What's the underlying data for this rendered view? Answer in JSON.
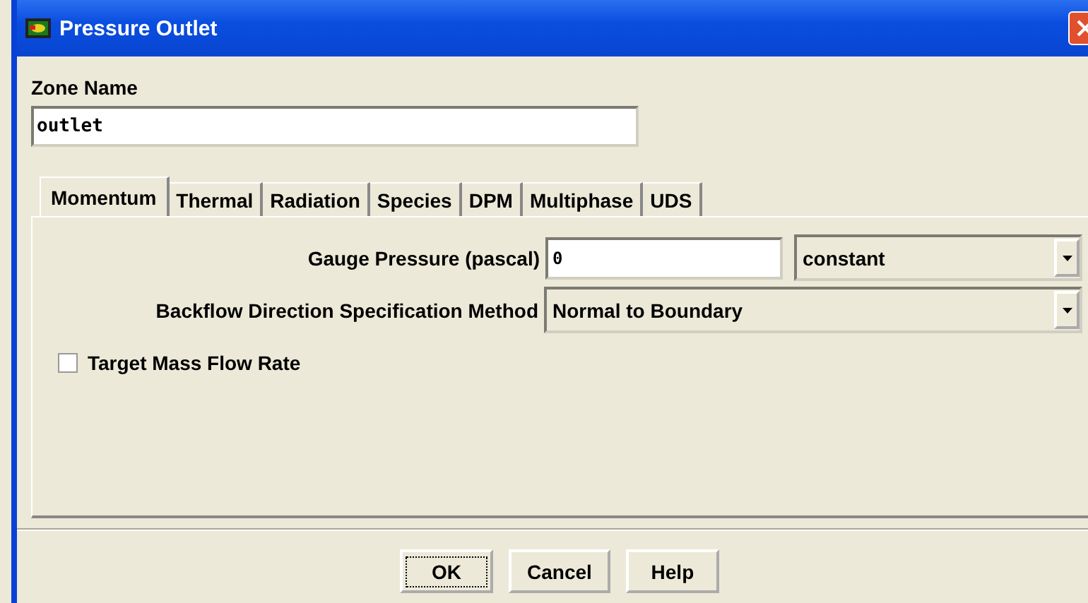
{
  "window": {
    "title": "Pressure Outlet"
  },
  "zone_name": {
    "label": "Zone Name",
    "value": "outlet"
  },
  "tabs": [
    {
      "label": "Momentum",
      "selected": true
    },
    {
      "label": "Thermal",
      "selected": false
    },
    {
      "label": "Radiation",
      "selected": false
    },
    {
      "label": "Species",
      "selected": false
    },
    {
      "label": "DPM",
      "selected": false
    },
    {
      "label": "Multiphase",
      "selected": false
    },
    {
      "label": "UDS",
      "selected": false
    }
  ],
  "gauge_pressure": {
    "label": "Gauge Pressure (pascal)",
    "value": "0",
    "method": "constant"
  },
  "backflow": {
    "label": "Backflow Direction Specification Method",
    "value": "Normal to Boundary"
  },
  "target_mass_flow_rate": {
    "label": "Target Mass Flow Rate",
    "checked": false
  },
  "buttons": [
    {
      "label": "OK",
      "focused": true
    },
    {
      "label": "Cancel",
      "focused": false
    },
    {
      "label": "Help",
      "focused": false
    }
  ]
}
